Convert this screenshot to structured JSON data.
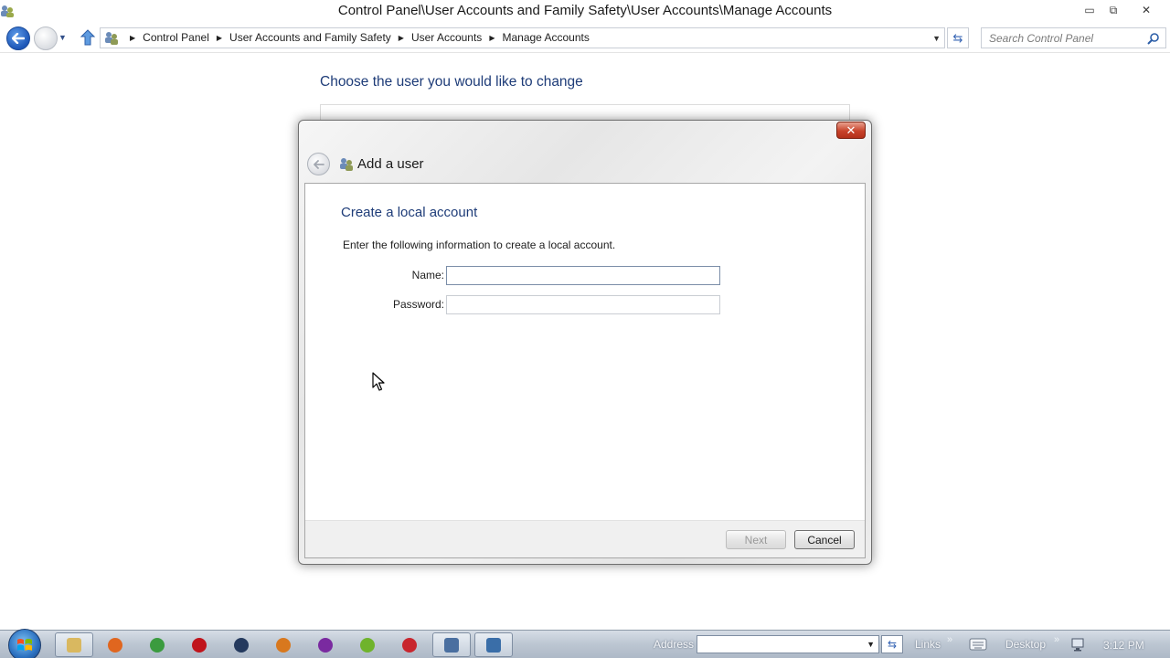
{
  "window": {
    "title": "Control Panel\\User Accounts and Family Safety\\User Accounts\\Manage Accounts",
    "minimize_glyph": "▭",
    "maximize_glyph": "⧉",
    "close_glyph": "✕"
  },
  "nav": {
    "breadcrumbs": [
      "Control Panel",
      "User Accounts and Family Safety",
      "User Accounts",
      "Manage Accounts"
    ],
    "search_placeholder": "Search Control Panel"
  },
  "page": {
    "heading": "Choose the user you would like to change"
  },
  "dialog": {
    "title": "Add a user",
    "close_glyph": "✕",
    "section_title": "Create a local account",
    "instructions": "Enter the following information to create a local account.",
    "name_label": "Name:",
    "name_value": "",
    "password_label": "Password:",
    "password_value": "",
    "next_label": "Next",
    "next_enabled": false,
    "cancel_label": "Cancel"
  },
  "taskbar": {
    "address_label": "Address",
    "links_label": "Links",
    "desktop_label": "Desktop",
    "chevron": "»",
    "clock": "3:12 PM",
    "apps": [
      {
        "name": "windows-explorer-icon",
        "color": "#d9b860"
      },
      {
        "name": "firefox-icon",
        "color": "#e0661f"
      },
      {
        "name": "chrome-icon",
        "color": "#3b9b3f"
      },
      {
        "name": "red-app-icon",
        "color": "#c0141c"
      },
      {
        "name": "steam-icon",
        "color": "#253a5e"
      },
      {
        "name": "search-tool-icon",
        "color": "#d8781e"
      },
      {
        "name": "onenote-icon",
        "color": "#7a2aa0"
      },
      {
        "name": "green-app-icon",
        "color": "#6fb32c"
      },
      {
        "name": "opera-icon",
        "color": "#c8262e"
      },
      {
        "name": "user-accounts-icon",
        "color": "#4a6fa0"
      },
      {
        "name": "remote-desktop-icon",
        "color": "#3a6ea8"
      }
    ]
  },
  "colors": {
    "heading_blue": "#1e3c78",
    "nav_back_blue": "#1d57b8",
    "dialog_close_red": "#c8432a"
  }
}
